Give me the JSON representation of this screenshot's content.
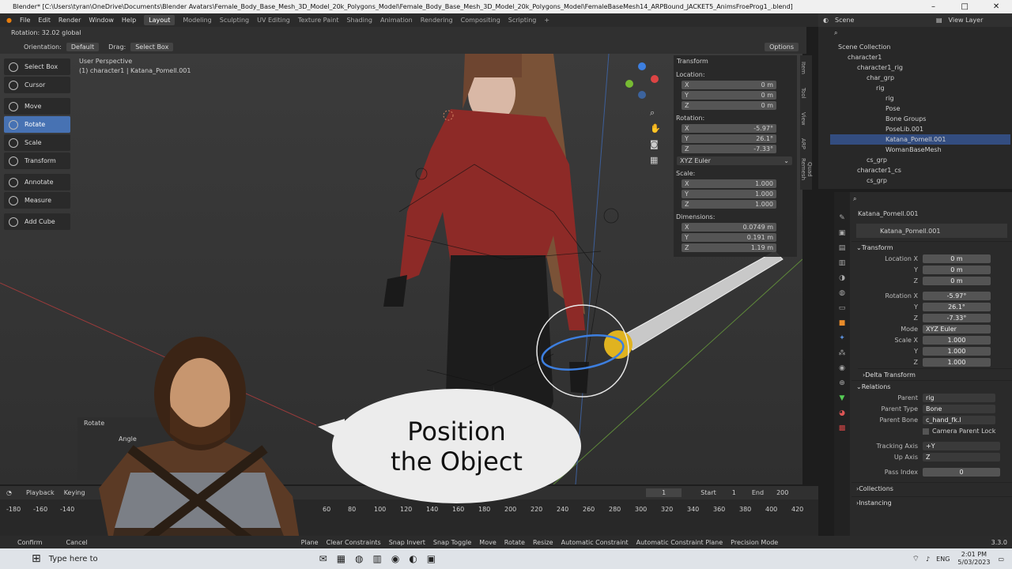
{
  "title_bar": {
    "text": "Blender* [C:\\Users\\tyran\\OneDrive\\Documents\\Blender Avatars\\Female_Body_Base_Mesh_3D_Model_20k_Polygons_Model\\Female_Body_Base_Mesh_3D_Model_20k_Polygons_Model\\FemaleBaseMesh14_ARPBound_JACKET5_AnimsFroeProg1_.blend]"
  },
  "menu": [
    "File",
    "Edit",
    "Render",
    "Window",
    "Help"
  ],
  "workspaces": [
    "Layout",
    "Modeling",
    "Sculpting",
    "UV Editing",
    "Texture Paint",
    "Shading",
    "Animation",
    "Rendering",
    "Compositing",
    "Scripting",
    "+"
  ],
  "header": {
    "rotation_status": "Rotation: 32.02 global",
    "orientation_label": "Orientation:",
    "orientation_value": "Default",
    "drag_label": "Drag:",
    "drag_value": "Select Box",
    "options": "Options"
  },
  "viewport": {
    "perspective": "User Perspective",
    "object": "(1) character1 | Katana_Pomell.001"
  },
  "tools": [
    "Select Box",
    "Cursor",
    "Move",
    "Rotate",
    "Scale",
    "Transform",
    "Annotate",
    "Measure",
    "Add Cube"
  ],
  "npanel": {
    "title": "Transform",
    "location_label": "Location:",
    "location": [
      [
        "X",
        "0 m"
      ],
      [
        "Y",
        "0 m"
      ],
      [
        "Z",
        "0 m"
      ]
    ],
    "rotation_label": "Rotation:",
    "rotation": [
      [
        "X",
        "-5.97°"
      ],
      [
        "Y",
        "26.1°"
      ],
      [
        "Z",
        "-7.33°"
      ]
    ],
    "rotation_mode": "XYZ Euler",
    "scale_label": "Scale:",
    "scale": [
      [
        "X",
        "1.000"
      ],
      [
        "Y",
        "1.000"
      ],
      [
        "Z",
        "1.000"
      ]
    ],
    "dimensions_label": "Dimensions:",
    "dimensions": [
      [
        "X",
        "0.0749 m"
      ],
      [
        "Y",
        "0.191 m"
      ],
      [
        "Z",
        "1.19 m"
      ]
    ],
    "tabs": [
      "Item",
      "Tool",
      "View",
      "ARP",
      "Quad Remesh"
    ]
  },
  "rotate_operator": {
    "title": "Rotate",
    "angle_label": "Angle"
  },
  "speech_bubble": {
    "line1": "Position",
    "line2": "the Object"
  },
  "outliner": {
    "scene": "Scene",
    "view_layer": "View Layer",
    "rows": [
      {
        "label": "Scene Collection",
        "indent": 0,
        "sel": false
      },
      {
        "label": "character1",
        "indent": 1,
        "sel": false
      },
      {
        "label": "character1_rig",
        "indent": 2,
        "sel": false
      },
      {
        "label": "char_grp",
        "indent": 3,
        "sel": false
      },
      {
        "label": "rig",
        "indent": 4,
        "sel": false
      },
      {
        "label": "rig",
        "indent": 5,
        "sel": false
      },
      {
        "label": "Pose",
        "indent": 5,
        "sel": false
      },
      {
        "label": "Bone Groups",
        "indent": 5,
        "sel": false
      },
      {
        "label": "PoseLib.001",
        "indent": 5,
        "sel": false
      },
      {
        "label": "Katana_Pomell.001",
        "indent": 5,
        "sel": true
      },
      {
        "label": "WomanBaseMesh",
        "indent": 5,
        "sel": false
      },
      {
        "label": "cs_grp",
        "indent": 3,
        "sel": false
      },
      {
        "label": "character1_cs",
        "indent": 2,
        "sel": false
      },
      {
        "label": "cs_grp",
        "indent": 3,
        "sel": false
      }
    ]
  },
  "properties": {
    "object_name": "Katana_Pomell.001",
    "datablock": "Katana_Pomell.001",
    "transform_title": "Transform",
    "location": [
      [
        "Location X",
        "0 m"
      ],
      [
        "Y",
        "0 m"
      ],
      [
        "Z",
        "0 m"
      ]
    ],
    "rotation": [
      [
        "Rotation X",
        "-5.97°"
      ],
      [
        "Y",
        "26.1°"
      ],
      [
        "Z",
        "-7.33°"
      ]
    ],
    "mode_label": "Mode",
    "mode_value": "XYZ Euler",
    "scale": [
      [
        "Scale X",
        "1.000"
      ],
      [
        "Y",
        "1.000"
      ],
      [
        "Z",
        "1.000"
      ]
    ],
    "delta": "Delta Transform",
    "relations_title": "Relations",
    "parent_label": "Parent",
    "parent_value": "rig",
    "parent_type_label": "Parent Type",
    "parent_type_value": "Bone",
    "parent_bone_label": "Parent Bone",
    "parent_bone_value": "c_hand_fk.l",
    "camera_lock": "Camera Parent Lock",
    "tracking_label": "Tracking Axis",
    "tracking_value": "+Y",
    "up_label": "Up Axis",
    "up_value": "Z",
    "pass_label": "Pass Index",
    "pass_value": "0",
    "collections": "Collections",
    "instancing": "Instancing"
  },
  "timeline": {
    "playback": "Playback",
    "keying": "Keying",
    "current_frame": "1",
    "start_label": "Start",
    "start": "1",
    "end_label": "End",
    "end": "200",
    "ticks": [
      "-180",
      "-160",
      "-140",
      "60",
      "80",
      "100",
      "120",
      "140",
      "160",
      "180",
      "200",
      "220",
      "240",
      "260",
      "280",
      "300",
      "320",
      "340",
      "360",
      "380",
      "400",
      "420"
    ]
  },
  "status_bar": [
    "Confirm",
    "Cancel",
    "Plane",
    "Clear Constraints",
    "Snap Invert",
    "Snap Toggle",
    "Move",
    "Rotate",
    "Resize",
    "Automatic Constraint",
    "Automatic Constraint Plane",
    "Precision Mode"
  ],
  "version": "3.3.0",
  "taskbar": {
    "search": "Type here to",
    "lang": "ENG",
    "time": "2:01 PM",
    "date": "5/03/2023"
  }
}
